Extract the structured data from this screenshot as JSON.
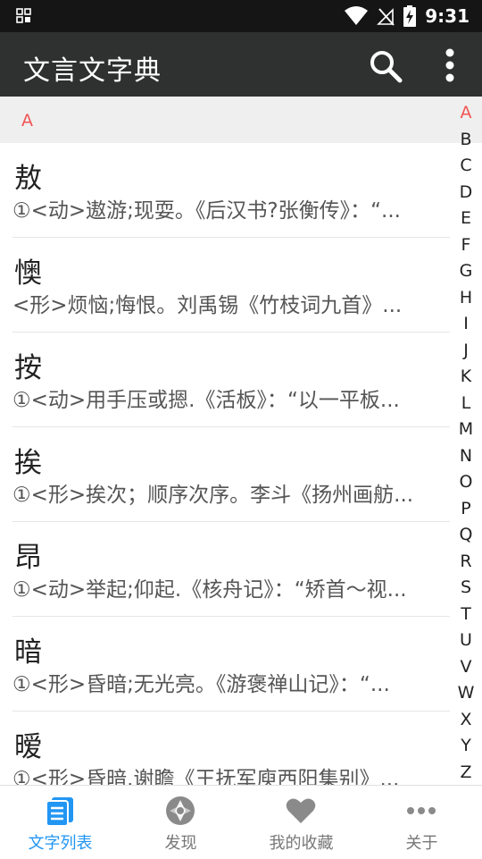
{
  "status": {
    "time": "9:31"
  },
  "appbar": {
    "title": "文言文字典"
  },
  "section": {
    "header": "A"
  },
  "items": [
    {
      "char": "敖",
      "def": "①<动>遨游;现耍。《后汉书?张衡传》：“..."
    },
    {
      "char": "懊",
      "def": "<形>烦恼;悔恨。刘禹锡《竹枝词九首》..."
    },
    {
      "char": "按",
      "def": "①<动>用手压或摁.《活板》：“以一平板..."
    },
    {
      "char": "挨",
      "def": "①<形>挨次；顺序次序。李斗《扬州画舫..."
    },
    {
      "char": "昂",
      "def": "①<动>举起;仰起.《核舟记》：“矫首～视..."
    },
    {
      "char": "暗",
      "def": "①<形>昏暗;无光亮。《游褒禅山记》：“..."
    },
    {
      "char": "暧",
      "def": "①<形>昏暗.谢瞻《王抚军庾西阳集别》..."
    }
  ],
  "index": {
    "letters": [
      "A",
      "B",
      "C",
      "D",
      "E",
      "F",
      "G",
      "H",
      "I",
      "J",
      "K",
      "L",
      "M",
      "N",
      "O",
      "P",
      "Q",
      "R",
      "S",
      "T",
      "U",
      "V",
      "W",
      "X",
      "Y",
      "Z"
    ],
    "active": "A"
  },
  "nav": [
    {
      "label": "文字列表",
      "icon": "list-icon",
      "active": true
    },
    {
      "label": "发现",
      "icon": "aperture-icon",
      "active": false
    },
    {
      "label": "我的收藏",
      "icon": "heart-icon",
      "active": false
    },
    {
      "label": "关于",
      "icon": "more-horizontal-icon",
      "active": false
    }
  ],
  "colors": {
    "accent": "#2196f3",
    "header_accent": "#f05454",
    "appbar": "#2f3030",
    "statusbar": "#151515"
  }
}
